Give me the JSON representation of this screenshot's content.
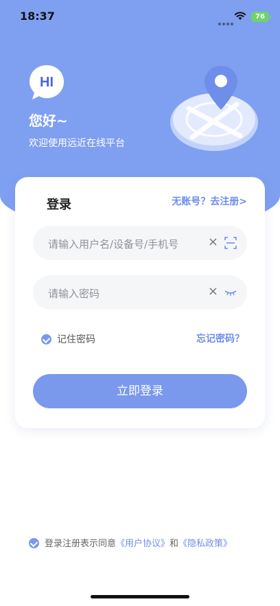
{
  "status_bar": {
    "time": "18:37",
    "battery": "76"
  },
  "hero": {
    "badge_text": "HI",
    "greeting": "您好~",
    "welcome": "欢迎使用远近在线平台"
  },
  "login_card": {
    "title": "登录",
    "register_link": "无账号？去注册>",
    "username_placeholder": "请输入用户名/设备号/手机号",
    "password_placeholder": "请输入密码",
    "remember_label": "记住密码",
    "forgot_link": "忘记密码？",
    "login_button": "立即登录"
  },
  "agreement": {
    "prefix": "登录注册表示同意",
    "user_agreement": "《用户协议》",
    "and": "和",
    "privacy_policy": "《隐私政策》"
  },
  "colors": {
    "primary": "#7f9ff1",
    "link": "#6e8ee9",
    "field_bg": "#f5f6f8"
  },
  "icons": [
    "wifi-icon",
    "battery-icon",
    "hi-badge-icon",
    "map-pin-illustration",
    "clear-icon",
    "scan-icon",
    "eye-closed-icon",
    "check-icon"
  ]
}
